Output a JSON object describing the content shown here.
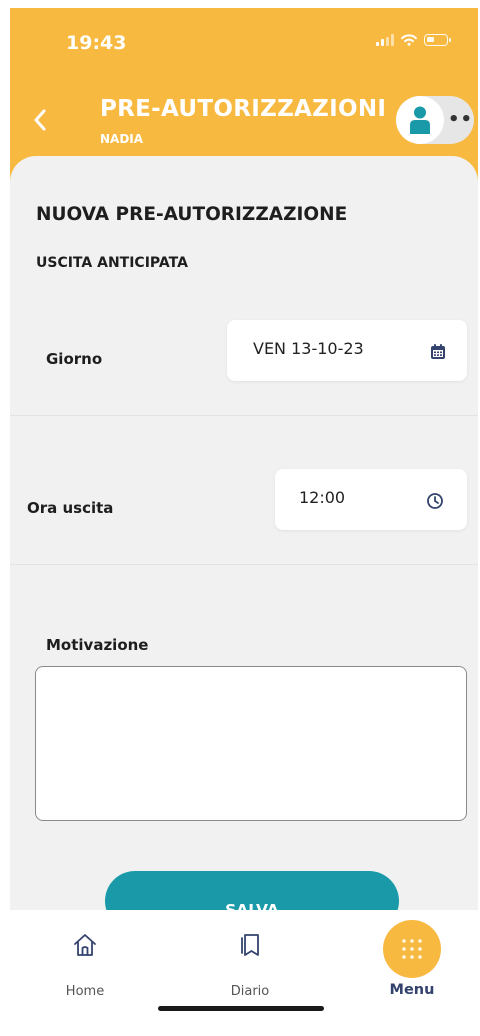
{
  "status_bar": {
    "time": "19:43",
    "signal_icon": "signal-icon",
    "wifi_icon": "wifi-icon",
    "battery_icon": "battery-icon"
  },
  "header": {
    "title": "PRE-AUTORIZZAZIONI",
    "subtitle": "NADIA",
    "back_icon": "chevron-left-icon",
    "avatar_icon": "user-icon",
    "more_icon": "more-icon",
    "more_text": "••"
  },
  "form": {
    "title": "NUOVA PRE-AUTORIZZAZIONE",
    "subtitle": "USCITA ANTICIPATA",
    "day": {
      "label": "Giorno",
      "value": "VEN 13-10-23",
      "icon": "calendar-icon"
    },
    "exit_time": {
      "label": "Ora uscita",
      "value": "12:00",
      "icon": "clock-icon"
    },
    "reason": {
      "label": "Motivazione",
      "value": ""
    },
    "save_label": "SALVA"
  },
  "bottom_nav": {
    "items": [
      {
        "label": "Home",
        "icon": "home-icon",
        "active": false
      },
      {
        "label": "Diario",
        "icon": "bookmark-icon",
        "active": false
      },
      {
        "label": "Menu",
        "icon": "grid-icon",
        "active": true
      }
    ]
  },
  "colors": {
    "accent": "#f8b940",
    "primary_button": "#1a9aa8",
    "active_nav": "#34436e",
    "background": "#f1f1f1"
  }
}
